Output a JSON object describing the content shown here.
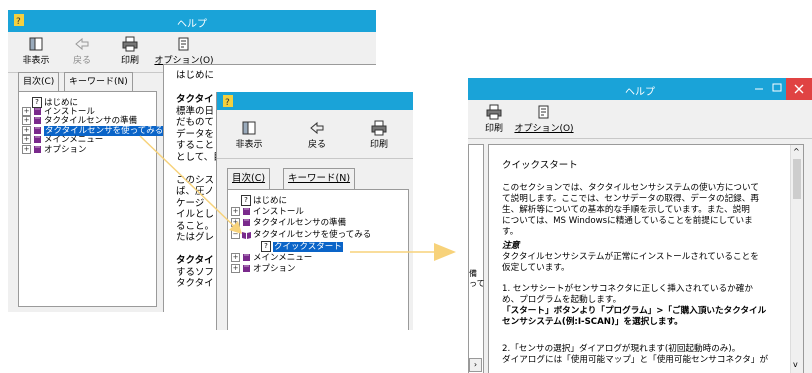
{
  "window_a": {
    "title": "ヘルプ",
    "toolbar": {
      "hide": "非表示",
      "back": "戻る",
      "print": "印刷",
      "options": "オプション(O)"
    },
    "tabs": {
      "contents": "目次(C)",
      "keyword": "キーワード(N)"
    },
    "tree": [
      {
        "label": "はじめに",
        "kind": "page"
      },
      {
        "label": "インストール",
        "kind": "book"
      },
      {
        "label": "タクタイルセンサの準備",
        "kind": "book"
      },
      {
        "label": "タクタイルセンサを使ってみる",
        "kind": "book",
        "selected": true
      },
      {
        "label": "メインメニュー",
        "kind": "book"
      },
      {
        "label": "オプション",
        "kind": "book"
      }
    ],
    "content_heading": "はじめに",
    "content_lines": [
      "タクタイ",
      "標準の日",
      "だものて",
      "データを",
      "すること",
      "として、目",
      "",
      "このシス",
      "ば、圧ノ",
      "ケージ",
      "イルとし",
      "ること。",
      "たはグレ",
      "",
      "タクタイ",
      "するソフ",
      "タクタイ"
    ]
  },
  "window_b": {
    "toolbar": {
      "hide": "非表示",
      "back": "戻る",
      "print": "印刷"
    },
    "tabs": {
      "contents": "目次(C)",
      "keyword": "キーワード(N)"
    },
    "tree": [
      {
        "label": "はじめに",
        "kind": "page"
      },
      {
        "label": "インストール",
        "kind": "book"
      },
      {
        "label": "タクタイルセンサの準備",
        "kind": "book"
      },
      {
        "label": "タクタイルセンサを使ってみる",
        "kind": "openbook"
      },
      {
        "label": "クイックスタート",
        "kind": "page",
        "selected": true
      },
      {
        "label": "メインメニュー",
        "kind": "book"
      },
      {
        "label": "オプション",
        "kind": "book"
      }
    ]
  },
  "window_c": {
    "title": "ヘルプ",
    "toolbar": {
      "print": "印刷",
      "options": "オプション(O)"
    },
    "left_fragments": [
      "備",
      "って"
    ],
    "content": {
      "heading": "クイックスタート",
      "intro": [
        "このセクションでは、タクタイルセンサシステムの使い方について",
        "て説明します。ここでは、センサデータの取得、データの記録、再",
        "生、解析等についての基本的な手順を示しています。また、説明",
        "については、MS Windowsに精通していることを前提にしていま",
        "す。"
      ],
      "note_title": "注意",
      "note": [
        "タクタイルセンサシステムが正常にインストールされていることを",
        "仮定しています。"
      ],
      "step1": [
        "1. センサシートがセンサコネクタに正しく挿入されているか確か",
        "め、プログラムを起動します。",
        "「スタート」ボタンより「プログラム」>「ご購入頂いたタクタイル",
        "センサシステム(例:I-SCAN)」を選択します。"
      ],
      "step2": [
        "2.「センサの選択」ダイアログが現れます(初回起動時のみ)。",
        "ダイアログには「使用可能マップ」と「使用可能センサコネクタ」が"
      ]
    }
  },
  "colors": {
    "titlebar": "#1aa3d8",
    "highlight": "#0a64c8",
    "arrow": "#f7d27a",
    "book": "#7a2a8c"
  }
}
